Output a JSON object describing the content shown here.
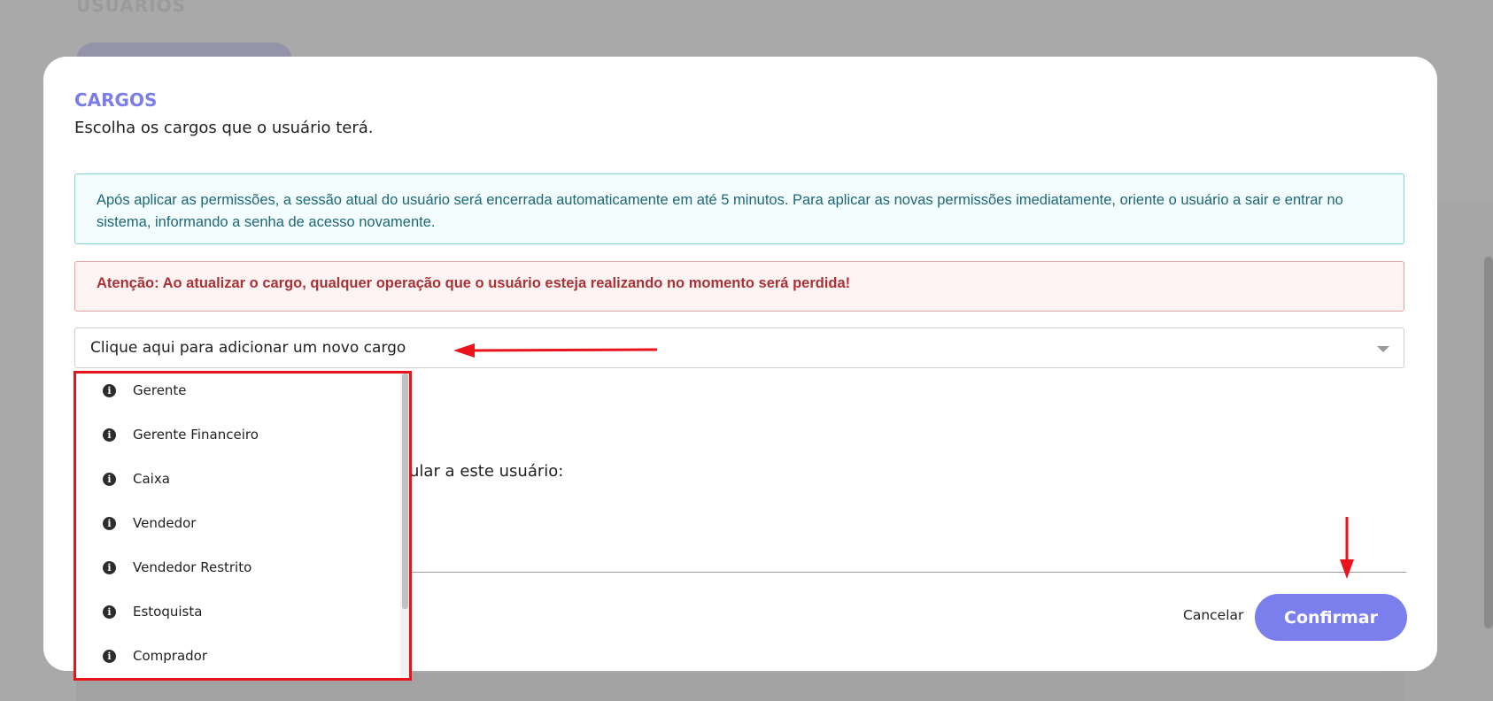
{
  "background": {
    "page_heading": "USUÁRIOS"
  },
  "modal": {
    "title": "CARGOS",
    "subtitle": "Escolha os cargos que o usuário terá.",
    "info_message": "Após aplicar as permissões, a sessão atual do usuário será encerrada automaticamente em até 5 minutos. Para aplicar as novas permissões imediatamente, oriente o usuário a sair e entrar no sistema, informando a senha de acesso novamente.",
    "warning_message": "Atenção: Ao atualizar o cargo, qualquer operação que o usuário esteja realizando no momento será perdida!",
    "select_placeholder": "Clique aqui para adicionar um novo cargo",
    "partial_label": "ular a este usuário:",
    "cancel_label": "Cancelar",
    "confirm_label": "Confirmar"
  },
  "dropdown": {
    "options": [
      {
        "label": "Gerente",
        "icon": "info-icon"
      },
      {
        "label": "Gerente Financeiro",
        "icon": "info-icon"
      },
      {
        "label": "Caixa",
        "icon": "info-icon"
      },
      {
        "label": "Vendedor",
        "icon": "info-icon"
      },
      {
        "label": "Vendedor Restrito",
        "icon": "info-icon"
      },
      {
        "label": "Estoquista",
        "icon": "info-icon"
      },
      {
        "label": "Comprador",
        "icon": "info-icon"
      }
    ]
  },
  "annotations": {
    "color": "#e8131b"
  },
  "colors": {
    "accent": "#7b7ee8",
    "confirm_button": "#7b7fee",
    "info_text": "#1d6776",
    "warning_text": "#a83236"
  }
}
